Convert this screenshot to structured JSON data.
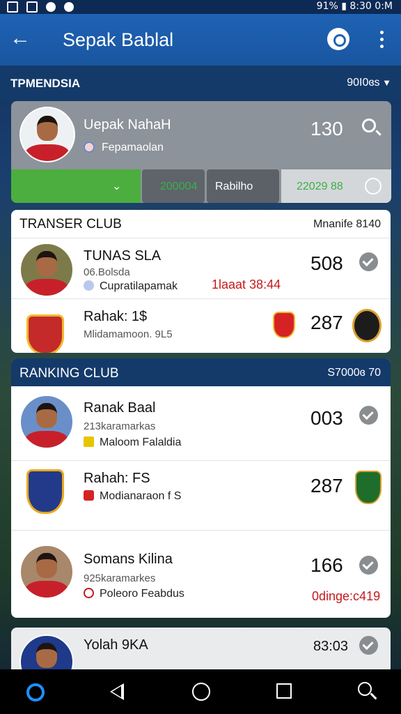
{
  "status_bar": {
    "time_text": "91% ▮ 8:30 0:M"
  },
  "app_bar": {
    "title": "Sepak Bablal"
  },
  "league": {
    "name": "TPMENDSIA",
    "selector": "90I0ɞs"
  },
  "featured": {
    "name": "Uepak NahaH",
    "subtitle": "Fepamaolan",
    "score": "130",
    "bar": {
      "green_value": "200004",
      "tab_label": "Rabilho",
      "right_value": "22029 88"
    }
  },
  "transfer_club": {
    "title": "TRANSER CLUB",
    "meta": "Mnanife 8140",
    "rows": [
      {
        "name": "TUNAS SLA",
        "sub1": "06.Bolsda",
        "sub2": "Cupratilapamak",
        "note": "1laaat 38:44",
        "score": "508"
      },
      {
        "name": "Rahak: 1$",
        "sub1": "Mlidamamoon. 9L5",
        "score": "287"
      }
    ]
  },
  "ranking_club": {
    "title": "RANKING CLUB",
    "meta": "S7000ɞ 70",
    "rows": [
      {
        "name": "Ranak Baal",
        "sub1": "213karamarkas",
        "sub2": "Maloom Falaldia",
        "score": "003"
      },
      {
        "name": "Rahah: FS",
        "sub1": "Modianaraon f S",
        "score": "287"
      },
      {
        "name": "Somans Kilina",
        "sub1": "925karamarkes",
        "sub2": "Poleoro Feabdus",
        "score": "166",
        "note": "0dinge:c419"
      }
    ]
  },
  "bottom_card": {
    "name": "Yolah 9KA",
    "score": "83:03"
  },
  "colors": {
    "primary": "#1e62b4",
    "header": "#143a6a",
    "accent_green": "#4cae3e",
    "alert_red": "#c4191d"
  }
}
